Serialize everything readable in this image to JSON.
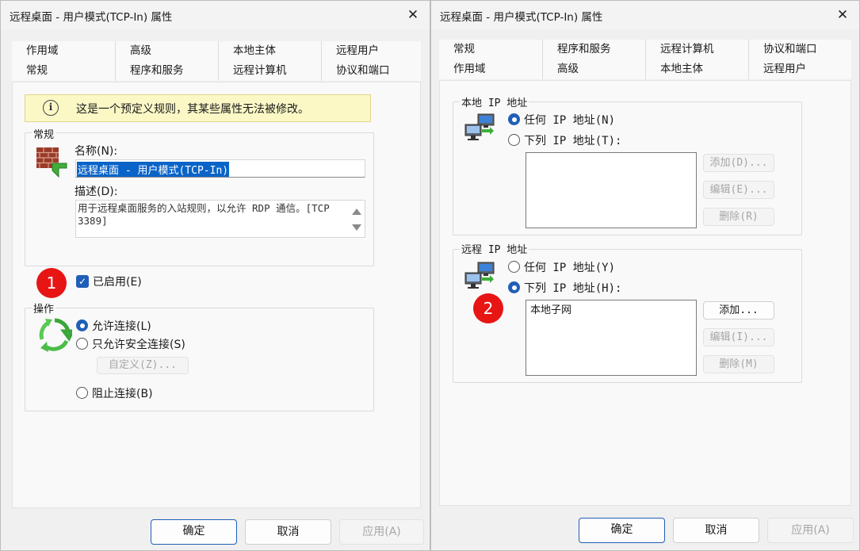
{
  "left_dialog": {
    "title": "远程桌面 - 用户模式(TCP-In) 属性",
    "tabs_row1": [
      "作用域",
      "高级",
      "本地主体",
      "远程用户"
    ],
    "tabs_row2": [
      "常规",
      "程序和服务",
      "远程计算机",
      "协议和端口"
    ],
    "active_tab": "常规",
    "info": "这是一个预定义规则，其某些属性无法被修改。",
    "general_group": "常规",
    "name_label": "名称(N):",
    "name_value": "远程桌面 - 用户模式(TCP-In)",
    "desc_label": "描述(D):",
    "desc_value": "用于远程桌面服务的入站规则，以允许 RDP 通信。[TCP 3389]",
    "enabled_label": "已启用(E)",
    "enabled_checked": true,
    "action_group": "操作",
    "allow_label": "允许连接(L)",
    "allow_secure_label": "只允许安全连接(S)",
    "customize_button": "自定义(Z)...",
    "block_label": "阻止连接(B)",
    "ok_button": "确定",
    "cancel_button": "取消",
    "apply_button": "应用(A)",
    "badge": "1"
  },
  "right_dialog": {
    "title": "远程桌面 - 用户模式(TCP-In) 属性",
    "tabs_row1": [
      "常规",
      "程序和服务",
      "远程计算机",
      "协议和端口"
    ],
    "tabs_row2": [
      "作用域",
      "高级",
      "本地主体",
      "远程用户"
    ],
    "active_tab": "作用域",
    "local_group": "本地 IP 地址",
    "local_any": "任何 IP 地址(N)",
    "local_these": "下列 IP 地址(T):",
    "local_add": "添加(D)...",
    "local_edit": "编辑(E)...",
    "local_remove": "删除(R)",
    "remote_group": "远程 IP 地址",
    "remote_any": "任何 IP 地址(Y)",
    "remote_these": "下列 IP 地址(H):",
    "remote_list": [
      "本地子网"
    ],
    "remote_add": "添加...",
    "remote_edit": "编辑(I)...",
    "remote_remove": "删除(M)",
    "ok_button": "确定",
    "cancel_button": "取消",
    "apply_button": "应用(A)",
    "badge": "2"
  },
  "colors": {
    "accent": "#1f5fb7",
    "selection": "#0a64c8",
    "info_bg": "#fbf8c6",
    "badge": "#e81515"
  },
  "icons": [
    "close-icon",
    "info-icon",
    "firewall-rule-icon",
    "actions-arrows-icon",
    "network-computers-icon",
    "checkmark-icon"
  ]
}
